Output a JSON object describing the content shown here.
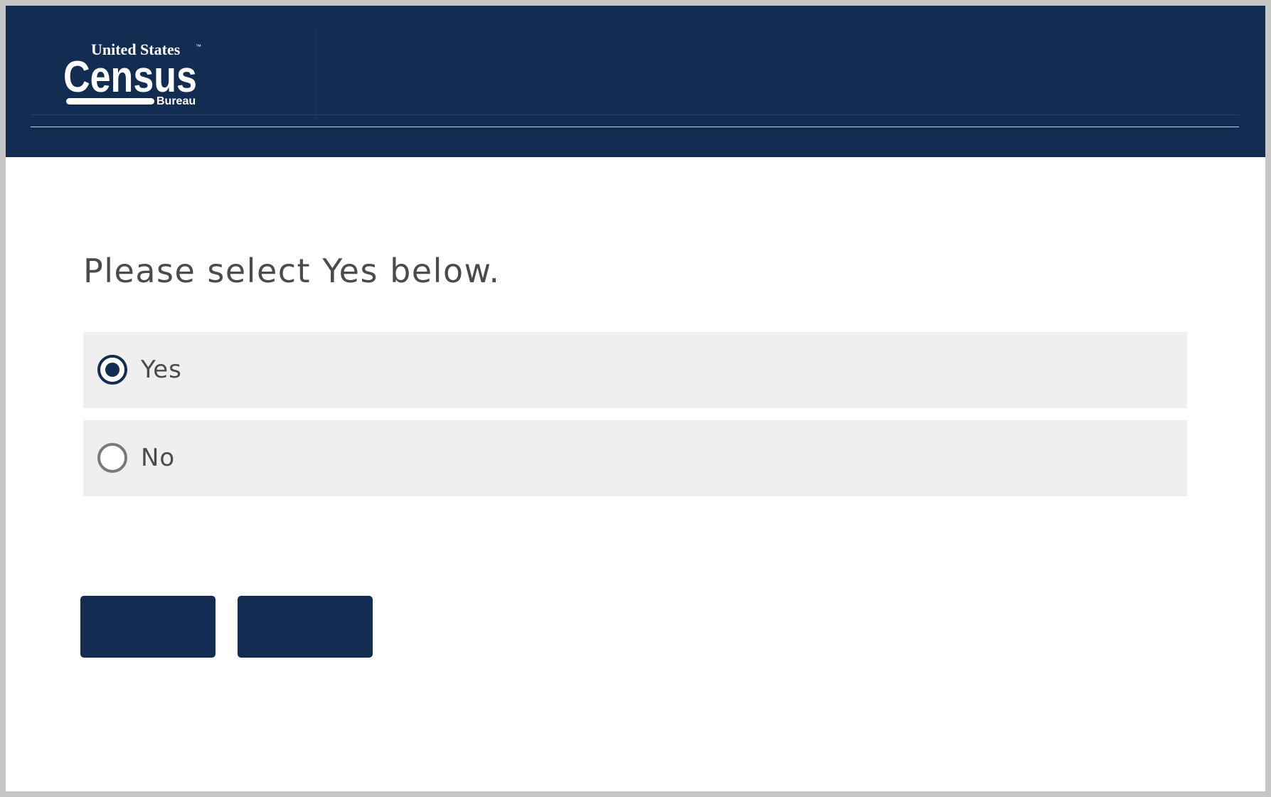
{
  "header": {
    "logo": {
      "line1": "United States",
      "trademark": "™",
      "line2": "Census",
      "line3": "Bureau"
    }
  },
  "question": {
    "text": "Please select Yes below.",
    "options": [
      {
        "label": "Yes",
        "selected": true
      },
      {
        "label": "No",
        "selected": false
      }
    ]
  },
  "buttons": [
    {
      "label": ""
    },
    {
      "label": ""
    }
  ],
  "colors": {
    "brand_navy": "#122d51",
    "option_bg": "#efefef",
    "text": "#4b4b4b",
    "page_border": "#c6c6c6"
  }
}
